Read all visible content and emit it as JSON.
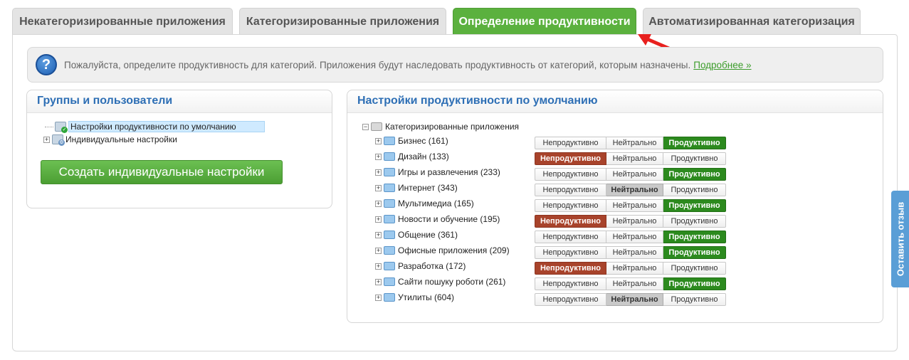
{
  "tabs": [
    {
      "label": "Некатегоризированные приложения",
      "active": false
    },
    {
      "label": "Категоризированные приложения",
      "active": false
    },
    {
      "label": "Определение продуктивности",
      "active": true
    },
    {
      "label": "Автоматизированная категоризация",
      "active": false
    }
  ],
  "info": {
    "text": "Пожалуйста, определите продуктивность для категорий. Приложения будут наследовать продуктивность от категорий, которым назначены.",
    "link": "Подробнее »"
  },
  "groups": {
    "title": "Группы и пользователи",
    "items": [
      {
        "label": "Настройки продуктивности по умолчанию",
        "selected": true
      },
      {
        "label": "Индивидуальные настройки",
        "selected": false
      }
    ],
    "create_button": "Создать индивидуальные настройки"
  },
  "defaults": {
    "title": "Настройки продуктивности по умолчанию",
    "root": "Категоризированные приложения",
    "option_labels": [
      "Непродуктивно",
      "Нейтрально",
      "Продуктивно"
    ],
    "categories": [
      {
        "label": "Бизнес (161)",
        "value": "Продуктивно"
      },
      {
        "label": "Дизайн (133)",
        "value": "Непродуктивно"
      },
      {
        "label": "Игры и развлечения (233)",
        "value": "Продуктивно"
      },
      {
        "label": "Интернет (343)",
        "value": "Нейтрально"
      },
      {
        "label": "Мультимедиа (165)",
        "value": "Продуктивно"
      },
      {
        "label": "Новости и обучение (195)",
        "value": "Непродуктивно"
      },
      {
        "label": "Общение (361)",
        "value": "Продуктивно"
      },
      {
        "label": "Офисные приложения (209)",
        "value": "Продуктивно"
      },
      {
        "label": "Разработка (172)",
        "value": "Непродуктивно"
      },
      {
        "label": "Сайти пошуку роботи (261)",
        "value": "Продуктивно"
      },
      {
        "label": "Утилиты (604)",
        "value": "Нейтрально"
      }
    ]
  },
  "feedback": "Оставить отзыв",
  "colors": {
    "active_tab": "#5bb13e",
    "unproductive": "#a8432b",
    "neutral": "#c9c9c9",
    "productive": "#2c8a1e",
    "heading": "#2e6fb5",
    "arrow": "#e8201e"
  }
}
